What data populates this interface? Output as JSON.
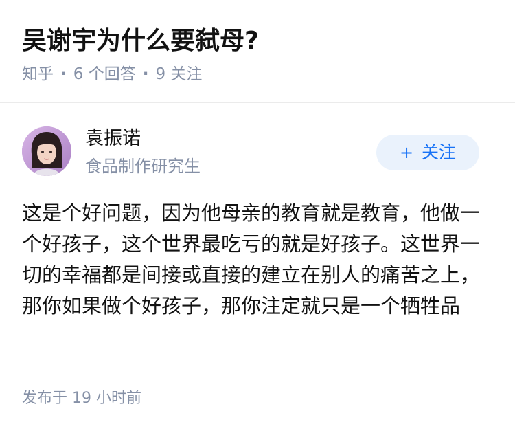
{
  "question": {
    "title": "吴谢宇为什么要弑母?",
    "source": "知乎",
    "answer_count": "6 个回答",
    "follower_count": "9 关注"
  },
  "answer": {
    "author": {
      "name": "袁振诺",
      "bio": "食品制作研究生"
    },
    "follow_plus": "+",
    "follow_label": "关注",
    "content": "这是个好问题，因为他母亲的教育就是教育，他做一个好孩子，这个世界最吃亏的就是好孩子。这世界一切的幸福都是间接或直接的建立在别人的痛苦之上，那你如果做个好孩子，那你注定就只是一个牺牲品",
    "published": "发布于 19 小时前"
  },
  "icons": {
    "avatar": "user-avatar-photo"
  },
  "colors": {
    "text_primary": "#121212",
    "text_secondary": "#8590a6",
    "accent": "#1772f6",
    "accent_bg": "#eaf2fc",
    "divider": "#ebebeb"
  }
}
